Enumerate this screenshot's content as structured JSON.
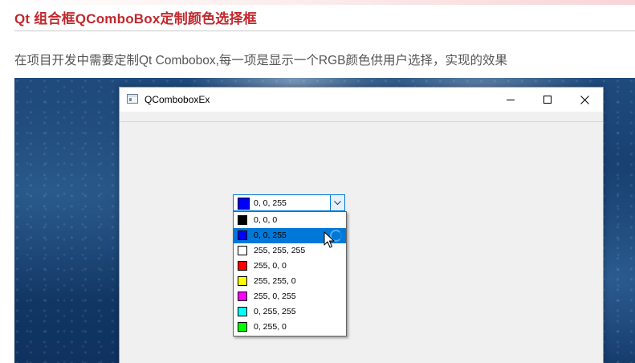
{
  "article": {
    "title": "Qt 组合框QComboBox定制颜色选择框",
    "description": "在项目开发中需要定制Qt Combobox,每一项是显示一个RGB颜色供用户选择，实现的效果"
  },
  "window": {
    "title": "QComboboxEx",
    "icon": "window-app-icon",
    "controls": [
      "minimize-icon",
      "maximize-icon",
      "close-icon"
    ]
  },
  "combobox": {
    "selected": {
      "label": "0, 0, 255",
      "color": "#0000ff"
    },
    "arrow_icon": "chevron-down-icon",
    "options": [
      {
        "label": "0, 0, 0",
        "color": "#000000"
      },
      {
        "label": "0, 0, 255",
        "color": "#0000ff"
      },
      {
        "label": "255, 255, 255",
        "color": "#ffffff"
      },
      {
        "label": "255, 0, 0",
        "color": "#ff0000"
      },
      {
        "label": "255, 255, 0",
        "color": "#ffff00"
      },
      {
        "label": "255, 0, 255",
        "color": "#ff00ff"
      },
      {
        "label": "0, 255, 255",
        "color": "#00ffff"
      },
      {
        "label": "0, 255, 0",
        "color": "#00ff00"
      }
    ],
    "highlighted_index": 1
  },
  "colors": {
    "title_red": "#c0282d",
    "selection_blue": "#0078d7"
  }
}
